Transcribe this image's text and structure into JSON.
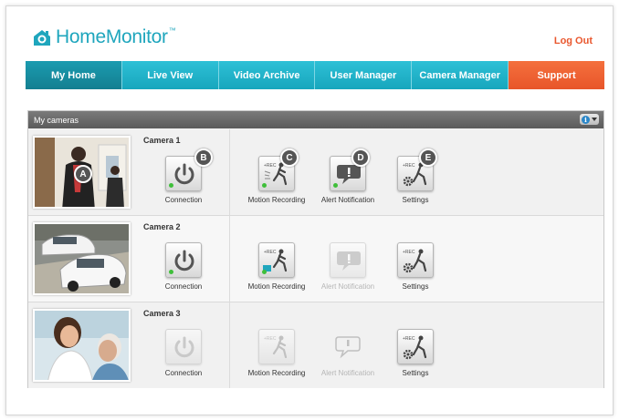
{
  "header": {
    "logo_text": "HomeMonitor",
    "logo_tm": "™",
    "logout": "Log Out"
  },
  "nav": {
    "items": [
      {
        "label": "My Home"
      },
      {
        "label": "Live View"
      },
      {
        "label": "Video Archive"
      },
      {
        "label": "User Manager"
      },
      {
        "label": "Camera Manager"
      },
      {
        "label": "Support"
      }
    ]
  },
  "panel": {
    "title": "My cameras",
    "info_glyph": "i"
  },
  "cameras": [
    {
      "name": "Camera 1",
      "connection_label": "Connection",
      "motion_label": "Motion Recording",
      "alert_label": "Alert Notification",
      "settings_label": "Settings"
    },
    {
      "name": "Camera 2",
      "connection_label": "Connection",
      "motion_label": "Motion Recording",
      "alert_label": "Alert Notification",
      "settings_label": "Settings"
    },
    {
      "name": "Camera 3",
      "connection_label": "Connection",
      "motion_label": "Motion Recording",
      "alert_label": "Alert Notification",
      "settings_label": "Settings"
    }
  ],
  "callouts": [
    "A",
    "B",
    "C",
    "D",
    "E"
  ],
  "icons": {
    "power": "power-icon",
    "motion": "motion-person-icon",
    "alert": "speech-bubble-icon",
    "settings": "gear-person-icon"
  },
  "colors": {
    "brand_teal": "#1fa6bd",
    "support_orange": "#e8552a",
    "logout_orange": "#e9572e",
    "status_green": "#3fbf3a"
  }
}
